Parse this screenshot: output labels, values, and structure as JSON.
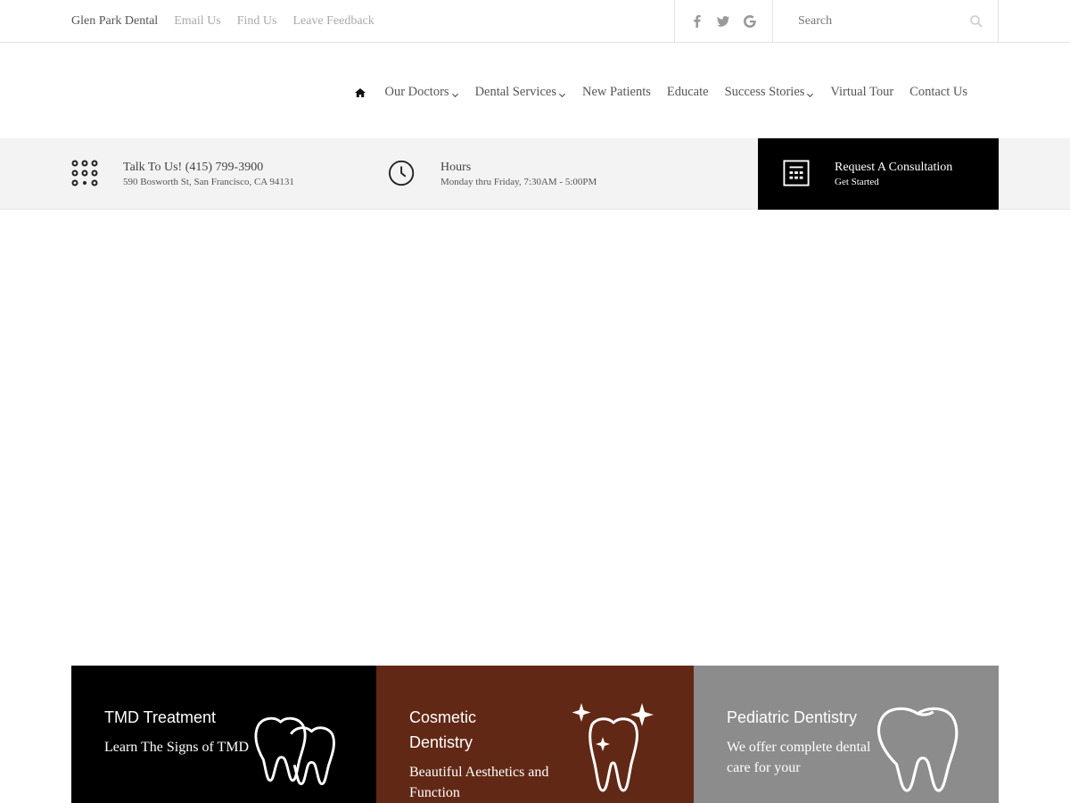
{
  "topbar": {
    "brand": "Glen Park Dental",
    "links": [
      "Email Us",
      "Find Us",
      "Leave Feedback"
    ],
    "social": [
      "facebook-icon",
      "twitter-icon",
      "google-icon"
    ],
    "search_placeholder": "Search"
  },
  "nav": {
    "items": [
      {
        "label": "Our Doctors",
        "dropdown": true
      },
      {
        "label": "Dental Services",
        "dropdown": true
      },
      {
        "label": "New Patients",
        "dropdown": false
      },
      {
        "label": "Educate",
        "dropdown": false
      },
      {
        "label": "Success Stories",
        "dropdown": true
      },
      {
        "label": "Virtual Tour",
        "dropdown": false
      },
      {
        "label": "Contact Us",
        "dropdown": false
      }
    ]
  },
  "info": {
    "phone_title": "Talk To Us! (415) 799-3900",
    "address": "590 Bosworth St, San Francisco, CA 94131",
    "hours_title": "Hours",
    "hours_text": "Monday thru Friday, 7:30AM - 5:00PM",
    "consult_title": "Request A Consultation",
    "consult_sub": "Get Started"
  },
  "cards": [
    {
      "title": "TMD Treatment",
      "desc": "Learn The Signs of TMD",
      "color": "#000000",
      "icon": "teeth-icon"
    },
    {
      "title": "Cosmetic Dentistry",
      "desc": "Beautiful Aesthetics and Function",
      "color": "#622816",
      "icon": "sparkling-tooth-icon"
    },
    {
      "title": "Pediatric Dentistry",
      "desc": "We offer complete dental care for your",
      "color": "#8c8c8c",
      "icon": "tooth-icon"
    }
  ]
}
